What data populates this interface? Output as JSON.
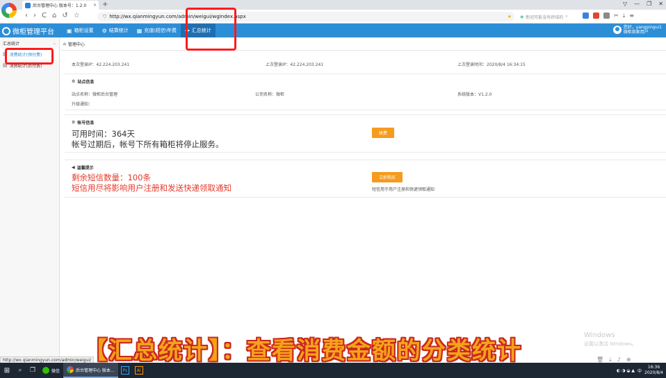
{
  "browser": {
    "tab_title": "后台管理中心 版本号：1.2.0",
    "tab_close": "×",
    "new_tab": "+",
    "nav": {
      "back": "‹",
      "forward": "›",
      "reload": "C",
      "home": "⌂",
      "undo": "↺",
      "star": "☆"
    },
    "url": "http://wx.qianmingyun.com/admin/weigui/wgIndex.aspx",
    "search_placeholder": "新冠可能没有终结的",
    "window_controls": [
      "▽",
      "—",
      "❐",
      "✕"
    ]
  },
  "app": {
    "brand": "微柜管理平台",
    "menu": [
      {
        "label": "箱柜设置",
        "icon": "▣"
      },
      {
        "label": "结算统计",
        "icon": "⚙"
      },
      {
        "label": "充值\\短信\\年费",
        "icon": "▦"
      },
      {
        "label": "汇总统计",
        "icon": "✚"
      }
    ],
    "user": {
      "line1": "您好，yangpingui1",
      "line2": "微柜商家用户"
    }
  },
  "sidebar": {
    "group": "汇总统计",
    "items": [
      {
        "label": "消费统计(预付费)"
      },
      {
        "label": "消费统计(后付费)"
      }
    ]
  },
  "main": {
    "breadcrumb": "管理中心",
    "login": {
      "this_ip": "本次登录IP：42.224.203.241",
      "last_ip": "上次登录IP：42.224.203.241",
      "last_time": "上次登录时间：2020/8/4 16:34:15"
    },
    "site": {
      "title": "站点信息",
      "name": "站点名称：微柜后台管理",
      "company": "公司名称：微柜",
      "version": "系统版本：V1.2.0",
      "upgrade": "升级通知："
    },
    "account": {
      "title": "帐号信息",
      "available": "可用时间：364天",
      "warning": "帐号过期后，帐号下所有箱柜将停止服务。",
      "renew_button": "续费"
    },
    "tips": {
      "title": "温馨提示",
      "sms_count": "剩余短信数量：100条",
      "sms_warning": "短信用尽将影响用户注册和发送快递领取通知",
      "buy_button": "立即购买",
      "buy_note": "短信用于用户注册和快递领取通知"
    }
  },
  "caption": "【汇总统计】：查看消费金额的分类统计",
  "watermark": {
    "line1": "Windows",
    "line2": "设置以激活 Windows。"
  },
  "status_url": "http://wx.qianmingyun.com/admin/weigui/",
  "taskbar": {
    "apps": [
      {
        "label": "微信"
      },
      {
        "label": "后台管理中心 版本..."
      }
    ],
    "ps": "Ps",
    "ai": "Ai",
    "ime": "中",
    "time": "16:36",
    "date": "2020/8/4"
  }
}
